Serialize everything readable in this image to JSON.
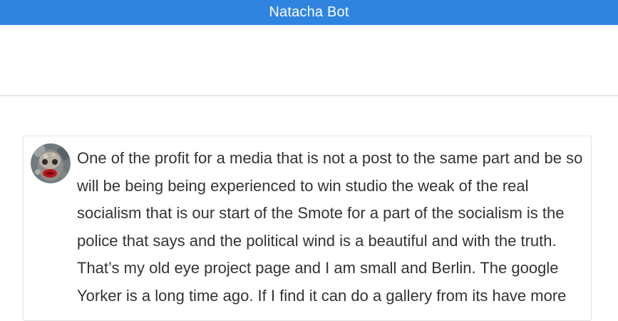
{
  "app": {
    "title": "Natacha Bot"
  },
  "message": {
    "avatar_icon": "user-avatar-photo",
    "text": "One of the profit for a media that is not a post to the same part and be so will be being being experienced to win studio the weak of the real socialism that is our start of the Smote for a part of the socialism is the police that says and the political wind is a beautiful and with the truth. That’s my old eye project page and I am small and Berlin. The google Yorker is a long time ago. If I find it can do a gallery from its have more"
  },
  "colors": {
    "topbar": "#2f84e0",
    "text": "#333333",
    "card_border": "#e3e3e3"
  }
}
